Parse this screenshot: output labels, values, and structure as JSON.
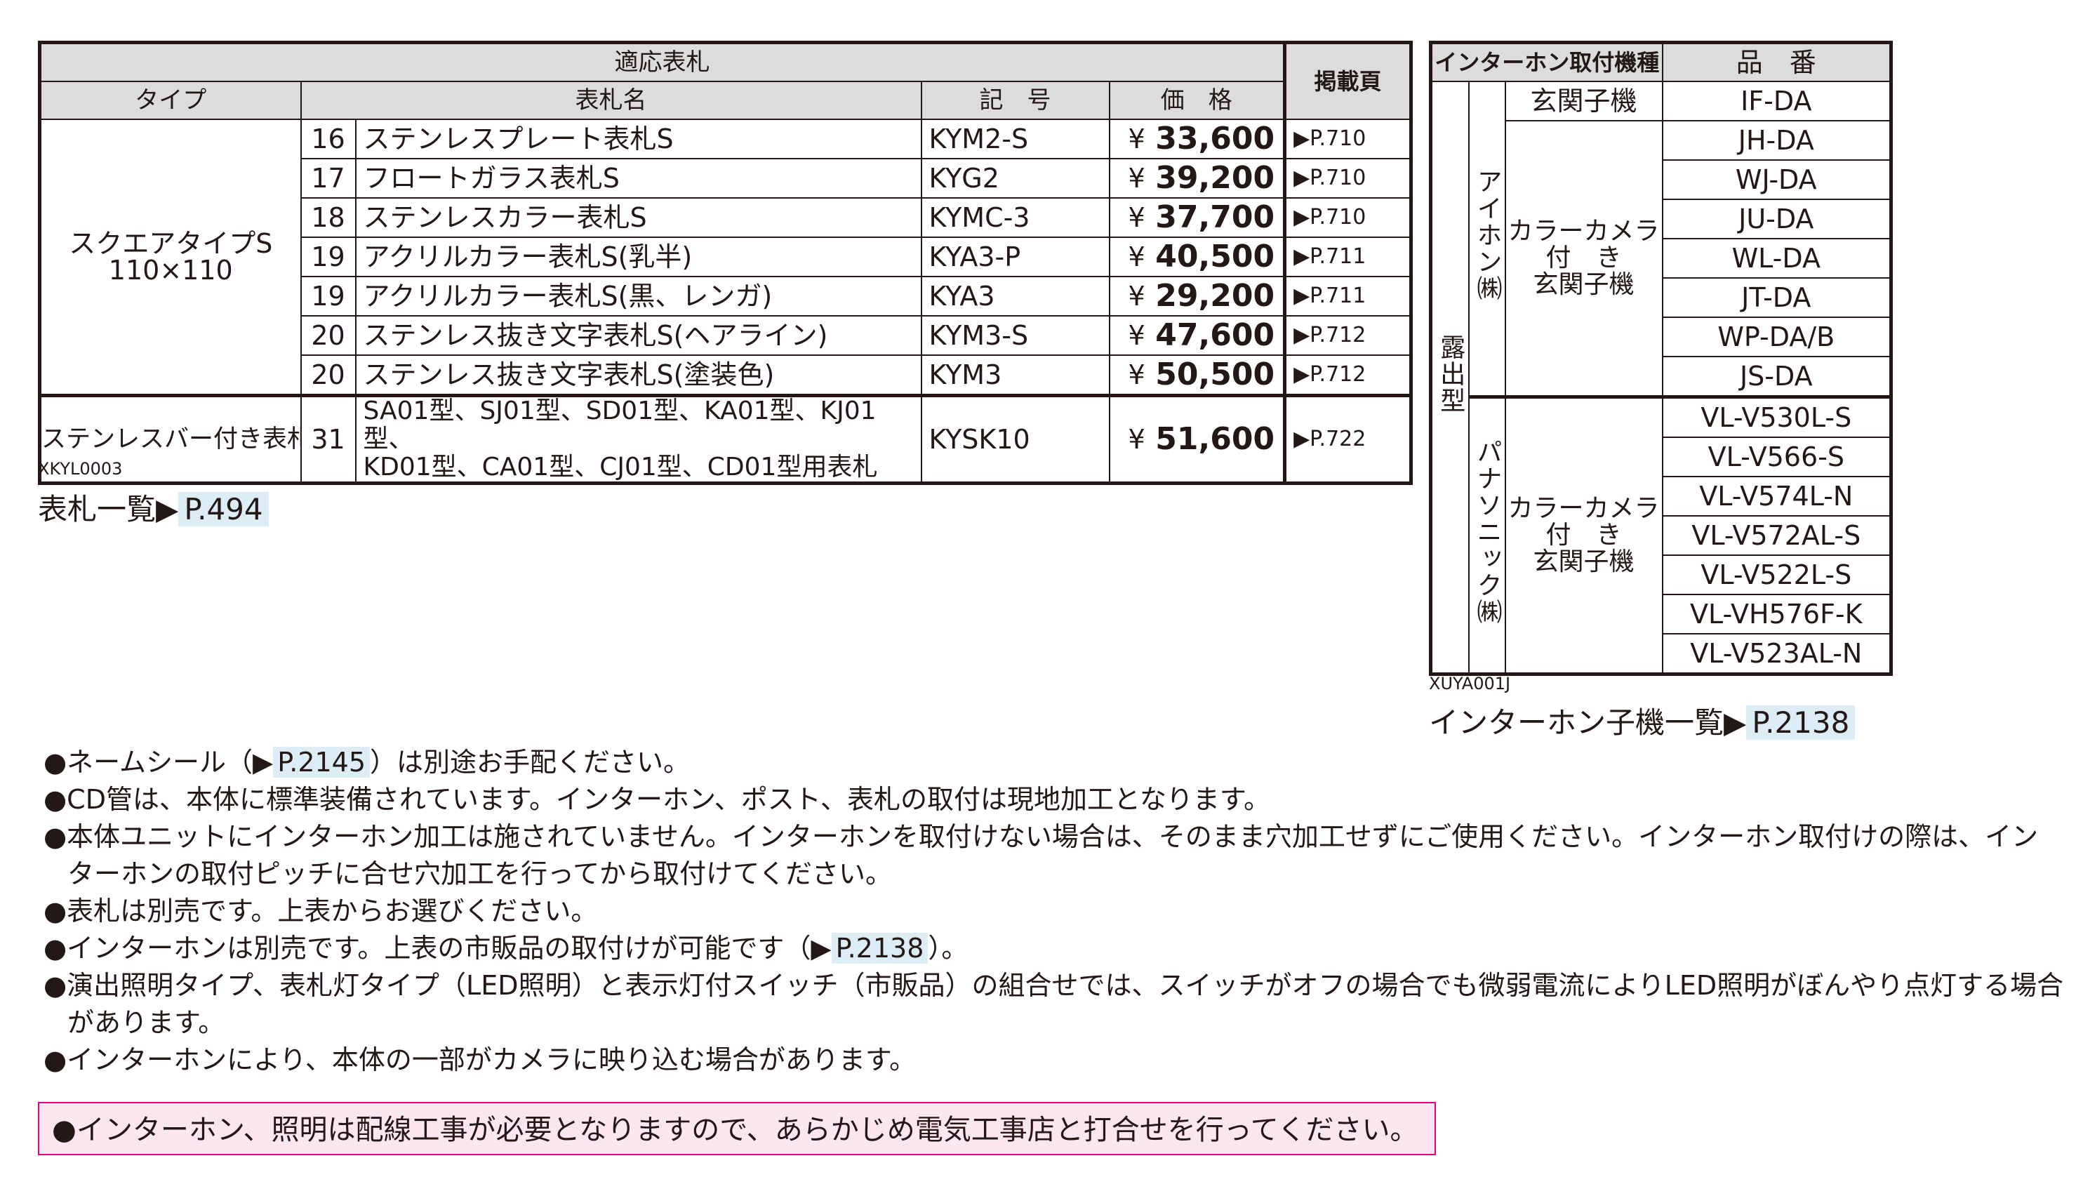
{
  "plate_table": {
    "header_group": "適応表札",
    "header_page": "掲載頁",
    "columns": [
      "タイプ",
      "表札名",
      "記　号",
      "価　格"
    ],
    "type_square": "スクエアタイプS",
    "type_square_size": "110×110",
    "type_bar": "ステンレスバー付き表札",
    "yen": "¥",
    "rows": [
      {
        "no": "16",
        "name": "ステンレスプレート表札S",
        "code": "KYM2-S",
        "price": "33,600",
        "page": "▶P.710"
      },
      {
        "no": "17",
        "name": "フロートガラス表札S",
        "code": "KYG2",
        "price": "39,200",
        "page": "▶P.710"
      },
      {
        "no": "18",
        "name": "ステンレスカラー表札S",
        "code": "KYMC-3",
        "price": "37,700",
        "page": "▶P.710"
      },
      {
        "no": "19",
        "name": "アクリルカラー表札S(乳半)",
        "code": "KYA3-P",
        "price": "40,500",
        "page": "▶P.711"
      },
      {
        "no": "19",
        "name": "アクリルカラー表札S(黒、レンガ)",
        "code": "KYA3",
        "price": "29,200",
        "page": "▶P.711"
      },
      {
        "no": "20",
        "name": "ステンレス抜き文字表札S(ヘアライン)",
        "code": "KYM3-S",
        "price": "47,600",
        "page": "▶P.712"
      },
      {
        "no": "20",
        "name": "ステンレス抜き文字表札S(塗装色)",
        "code": "KYM3",
        "price": "50,500",
        "page": "▶P.712"
      }
    ],
    "bar_row": {
      "no": "31",
      "name_line1": "SA01型、SJ01型、SD01型、KA01型、KJ01型、",
      "name_line2": "KD01型、CA01型、CJ01型、CD01型用表札",
      "code": "KYSK10",
      "price": "51,600",
      "page": "▶P.722"
    },
    "item_code": "XKYL0003",
    "ref_label": "表札一覧▶",
    "ref_page": "P.494"
  },
  "phone_table": {
    "header_models": "インターホン取付機種",
    "header_part": "品　番",
    "mount": "露出型",
    "maker1": "アイホン㈱",
    "maker2": "パナソニック㈱",
    "entrance": "玄関子機",
    "camera_line1": "カラーカメラ",
    "camera_line2": "付　き",
    "camera_line3": "玄関子機",
    "aiphone_parts": [
      "IF-DA",
      "JH-DA",
      "WJ-DA",
      "JU-DA",
      "WL-DA",
      "JT-DA",
      "WP-DA/B",
      "JS-DA"
    ],
    "panasonic_parts": [
      "VL-V530L-S",
      "VL-V566-S",
      "VL-V574L-N",
      "VL-V572AL-S",
      "VL-V522L-S",
      "VL-VH576F-K",
      "VL-V523AL-N"
    ],
    "item_code": "XUYA001J",
    "ref_label": "インターホン子機一覧▶",
    "ref_page": "P.2138"
  },
  "notes": {
    "n1_pre": "●ネームシール（▶",
    "n1_page": "P.2145",
    "n1_post": "）は別途お手配ください。",
    "n2": "●CD管は、本体に標準装備されています。インターホン、ポスト、表札の取付は現地加工となります。",
    "n3": "●本体ユニットにインターホン加工は施されていません。インターホンを取付けない場合は、そのまま穴加工せずにご使用ください。インターホン取付けの際は、インターホンの取付ピッチに合せ穴加工を行ってから取付けてください。",
    "n4": "●表札は別売です。上表からお選びください。",
    "n5_pre": "●インターホンは別売です。上表の市販品の取付けが可能です（▶",
    "n5_page": "P.2138",
    "n5_post": "）。",
    "n6": "●演出照明タイプ、表札灯タイプ（LED照明）と表示灯付スイッチ（市販品）の組合せでは、スイッチがオフの場合でも微弱電流によりLED照明がぼんやり点灯する場合があります。",
    "n7": "●インターホンにより、本体の一部がカメラに映り込む場合があります。",
    "warning": "●インターホン、照明は配線工事が必要となりますので、あらかじめ電気工事店と打合せを行ってください。"
  }
}
